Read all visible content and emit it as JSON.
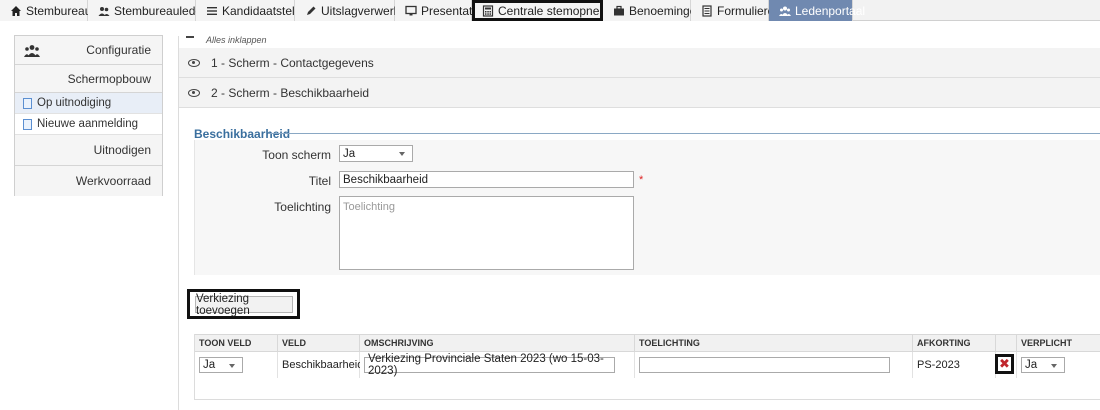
{
  "nav": {
    "tabs": [
      {
        "label": "Stembureaus",
        "icon": "home-icon"
      },
      {
        "label": "Stembureauleden",
        "icon": "users-icon"
      },
      {
        "label": "Kandidaatstelling",
        "icon": "list-icon"
      },
      {
        "label": "Uitslagverwerking",
        "icon": "pencil-icon"
      },
      {
        "label": "Presentatie",
        "icon": "monitor-icon"
      },
      {
        "label": "Centrale stemopneming",
        "icon": "calculator-icon"
      },
      {
        "label": "Benoemingen",
        "icon": "briefcase-icon"
      },
      {
        "label": "Formulieren",
        "icon": "forms-icon"
      },
      {
        "label": "Ledenportaal",
        "icon": "group-icon"
      }
    ],
    "highlighted_tab": "Centrale stemopneming",
    "active_tab": "Ledenportaal"
  },
  "sidebar": {
    "configuratie": "Configuratie",
    "schermopbouw": "Schermopbouw",
    "sub_items": [
      {
        "label": "Op uitnodiging",
        "selected": true
      },
      {
        "label": "Nieuwe aanmelding",
        "selected": false
      }
    ],
    "uitnodigen": "Uitnodigen",
    "werkvoorraad": "Werkvoorraad"
  },
  "main": {
    "collapse_all": "Alles inklappen",
    "screens": [
      {
        "label": "1 - Scherm - Contactgegevens"
      },
      {
        "label": "2 - Scherm - Beschikbaarheid"
      }
    ],
    "section_title": "Beschikbaarheid",
    "form": {
      "toon_scherm_label": "Toon scherm",
      "toon_scherm_value": "Ja",
      "titel_label": "Titel",
      "titel_value": "Beschikbaarheid",
      "required_mark": "*",
      "toelichting_label": "Toelichting",
      "toelichting_placeholder": "Toelichting"
    },
    "add_button": "Verkiezing toevoegen",
    "table": {
      "headers": [
        "TOON VELD",
        "VELD",
        "OMSCHRIJVING",
        "TOELICHTING",
        "AFKORTING",
        "",
        "VERPLICHT"
      ],
      "row": {
        "toon_veld": "Ja",
        "veld": "Beschikbaarheid",
        "omschrijving": "Verkiezing Provinciale Staten 2023 (wo 15-03-2023)",
        "toelichting": "",
        "afkorting": "PS-2023",
        "verplicht": "Ja"
      }
    }
  },
  "colors": {
    "active_tab": "#7089b0",
    "section_title": "#3a6f9e",
    "delete": "#c0262d"
  }
}
